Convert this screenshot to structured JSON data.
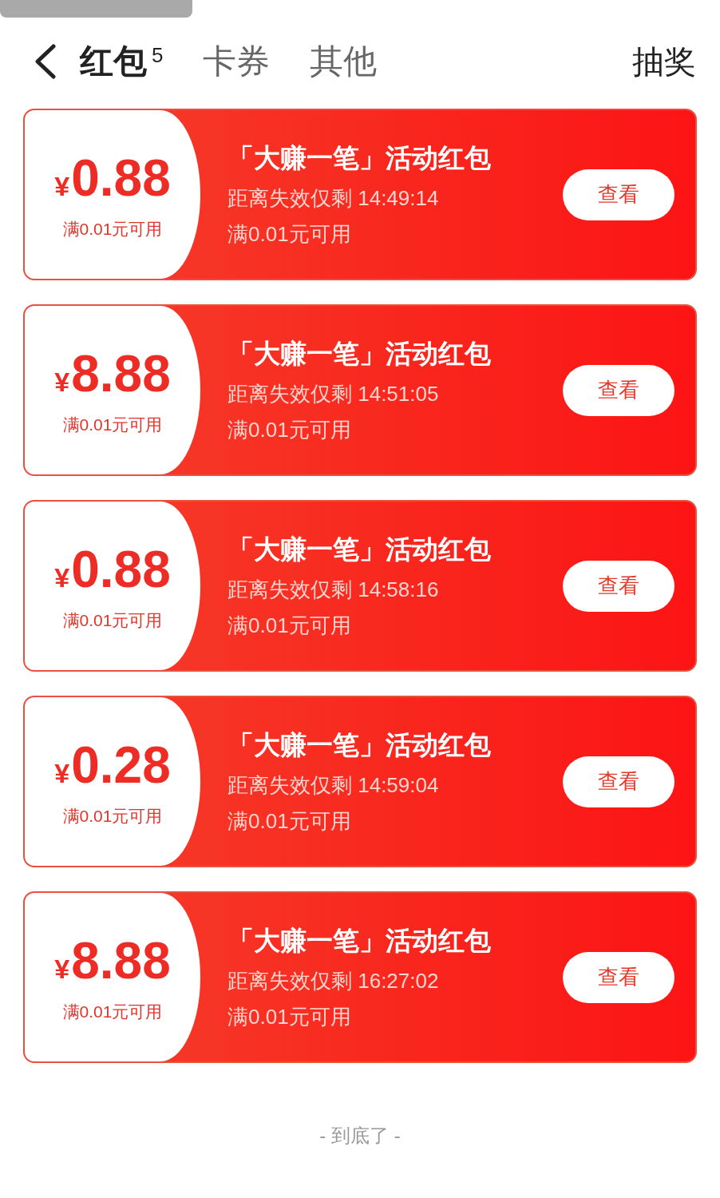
{
  "header": {
    "tabs": [
      {
        "label": "红包",
        "count": "5",
        "selected": true
      },
      {
        "label": "卡券",
        "selected": false
      },
      {
        "label": "其他",
        "selected": false
      }
    ],
    "action": "抽奖"
  },
  "coupons": [
    {
      "currency": "¥",
      "amount": "0.88",
      "threshold": "满0.01元可用",
      "title": "「大赚一笔」活动红包",
      "countdown": "距离失效仅剩 14:49:14",
      "condition": "满0.01元可用",
      "button": "查看"
    },
    {
      "currency": "¥",
      "amount": "8.88",
      "threshold": "满0.01元可用",
      "title": "「大赚一笔」活动红包",
      "countdown": "距离失效仅剩 14:51:05",
      "condition": "满0.01元可用",
      "button": "查看"
    },
    {
      "currency": "¥",
      "amount": "0.88",
      "threshold": "满0.01元可用",
      "title": "「大赚一笔」活动红包",
      "countdown": "距离失效仅剩 14:58:16",
      "condition": "满0.01元可用",
      "button": "查看"
    },
    {
      "currency": "¥",
      "amount": "0.28",
      "threshold": "满0.01元可用",
      "title": "「大赚一笔」活动红包",
      "countdown": "距离失效仅剩 14:59:04",
      "condition": "满0.01元可用",
      "button": "查看"
    },
    {
      "currency": "¥",
      "amount": "8.88",
      "threshold": "满0.01元可用",
      "title": "「大赚一笔」活动红包",
      "countdown": "距离失效仅剩 16:27:02",
      "condition": "满0.01元可用",
      "button": "查看"
    }
  ],
  "footer": "- 到底了 -"
}
